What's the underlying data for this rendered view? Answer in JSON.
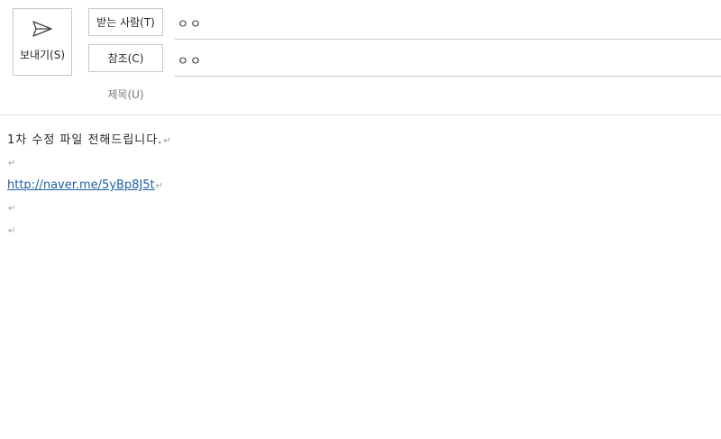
{
  "compose": {
    "send_label": "보내기(S)",
    "to_label": "받는 사람(T)",
    "to_value": "ㅇㅇ",
    "cc_label": "참조(C)",
    "cc_value": "ㅇㅇ",
    "subject_label": "제목(U)",
    "subject_value": ""
  },
  "body": {
    "line1": "1차 수정 파일 전해드립니다.",
    "link": "http://naver.me/5yBp8J5t",
    "paragraph_mark": "↵"
  },
  "colors": {
    "link": "#1f5fa8",
    "border": "#c8c8c8"
  },
  "icons": {
    "send": "send-icon"
  }
}
